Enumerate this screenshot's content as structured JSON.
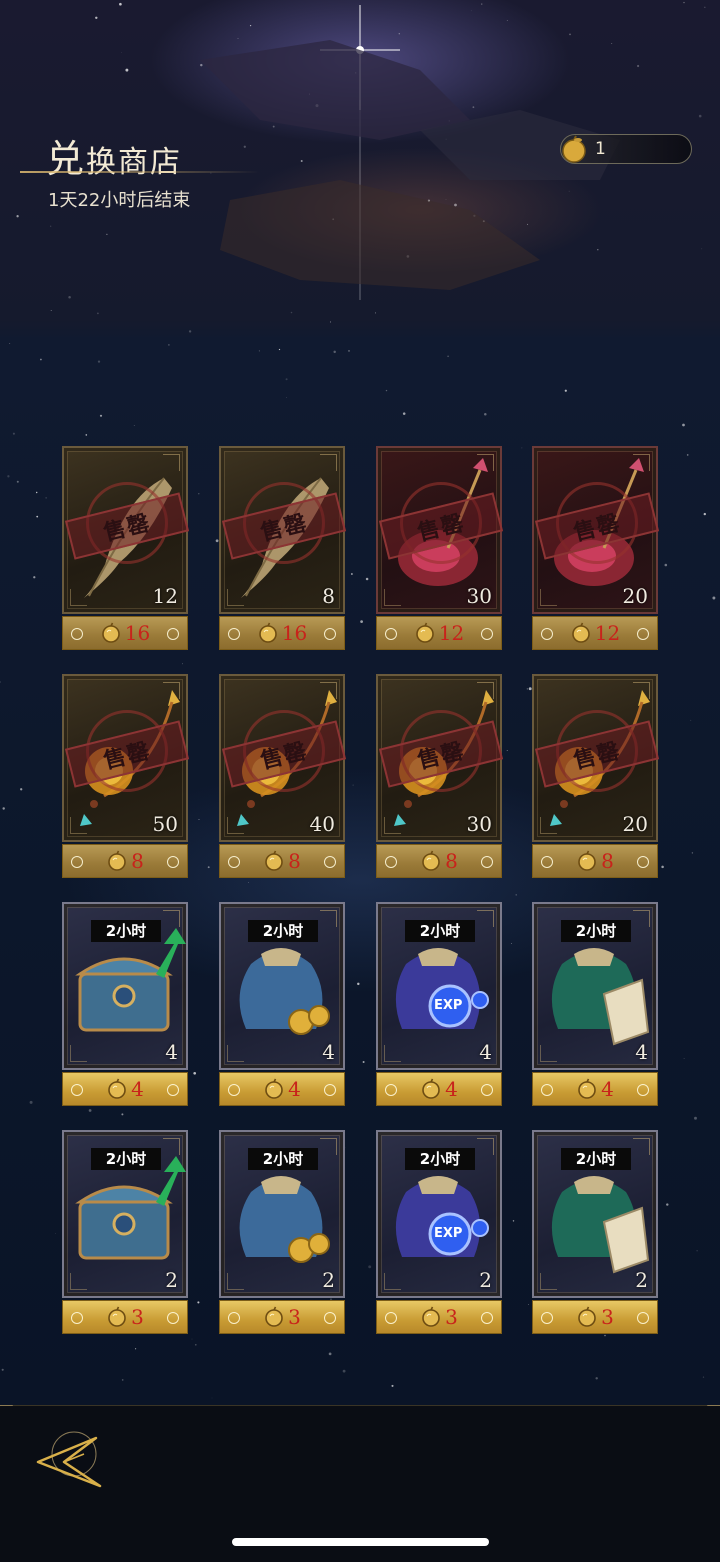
{
  "header": {
    "title_big": "兑",
    "title_rest": "换商店",
    "timer": "1天22小时后结束",
    "currency": {
      "icon": "golden-apple-icon",
      "amount": "1"
    }
  },
  "stamp_text": "售罄",
  "items": [
    {
      "art": "feather",
      "theme": "brown",
      "sold_out": true,
      "quantity": "12",
      "price": "16"
    },
    {
      "art": "feather",
      "theme": "brown",
      "sold_out": true,
      "quantity": "8",
      "price": "16"
    },
    {
      "art": "red-relic",
      "theme": "red",
      "sold_out": true,
      "quantity": "30",
      "price": "12"
    },
    {
      "art": "red-relic",
      "theme": "red",
      "sold_out": true,
      "quantity": "20",
      "price": "12"
    },
    {
      "art": "gold-pendulum",
      "theme": "brown",
      "sold_out": true,
      "quantity": "50",
      "price": "8"
    },
    {
      "art": "gold-pendulum",
      "theme": "brown",
      "sold_out": true,
      "quantity": "40",
      "price": "8"
    },
    {
      "art": "gold-pendulum",
      "theme": "brown",
      "sold_out": true,
      "quantity": "30",
      "price": "8"
    },
    {
      "art": "gold-pendulum",
      "theme": "brown",
      "sold_out": true,
      "quantity": "20",
      "price": "8"
    },
    {
      "art": "treasure-chest",
      "theme": "blue",
      "sold_out": false,
      "time": "2小时",
      "quantity": "4",
      "price": "4"
    },
    {
      "art": "gold-bag",
      "theme": "blue",
      "sold_out": false,
      "time": "2小时",
      "quantity": "4",
      "price": "4"
    },
    {
      "art": "exp-bag",
      "theme": "blue",
      "sold_out": false,
      "time": "2小时",
      "quantity": "4",
      "price": "4"
    },
    {
      "art": "scroll-bag",
      "theme": "blue",
      "sold_out": false,
      "time": "2小时",
      "quantity": "4",
      "price": "4"
    },
    {
      "art": "treasure-chest",
      "theme": "blue",
      "sold_out": false,
      "time": "2小时",
      "quantity": "2",
      "price": "3"
    },
    {
      "art": "gold-bag",
      "theme": "blue",
      "sold_out": false,
      "time": "2小时",
      "quantity": "2",
      "price": "3"
    },
    {
      "art": "exp-bag",
      "theme": "blue",
      "sold_out": false,
      "time": "2小时",
      "quantity": "2",
      "price": "3"
    },
    {
      "art": "scroll-bag",
      "theme": "blue",
      "sold_out": false,
      "time": "2小时",
      "quantity": "2",
      "price": "3"
    }
  ],
  "exp_label": "EXP",
  "footer": {
    "back_icon": "back-arrow-icon"
  },
  "colors": {
    "price_text": "#c8231b",
    "gold": "#d9b04a",
    "background": "#0c172b"
  }
}
